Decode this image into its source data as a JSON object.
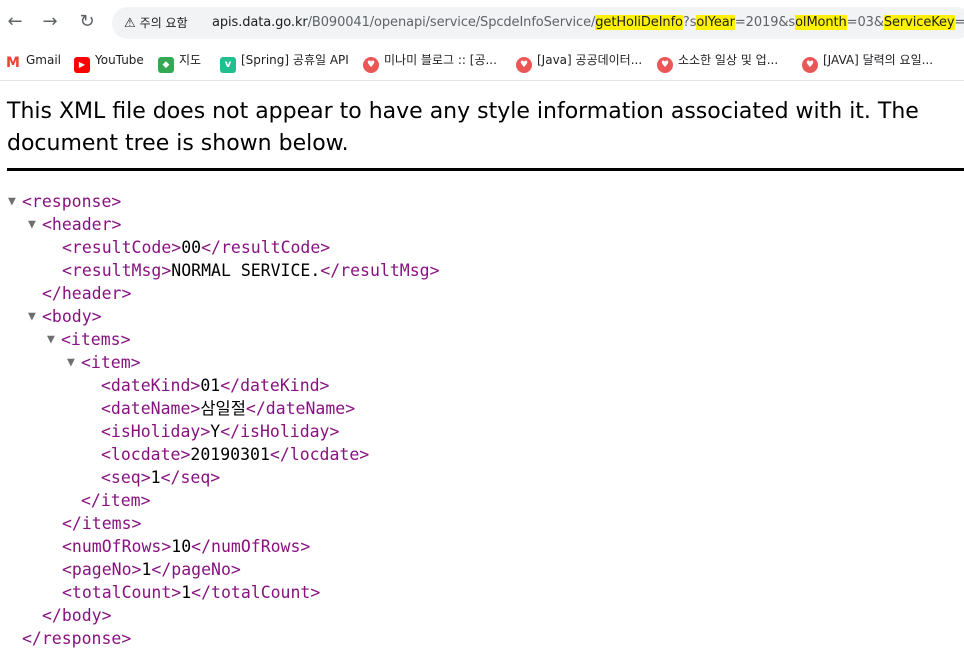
{
  "browser": {
    "back_icon": "←",
    "forward_icon": "→",
    "reload_icon": "↻",
    "security_chip": {
      "icon": "⚠",
      "label": "주의 요함"
    },
    "url": {
      "host": "apis.data.go.kr",
      "path": "/B090041/openapi/service/SpcdeInfoService/",
      "op": "getHoliDeInfo",
      "q1_pre": "?s",
      "q1_hl": "olYear",
      "q1_val": "=2019&s",
      "q2_hl": "olMonth",
      "q2_val": "=03&",
      "q3_hl": "ServiceKey",
      "q3_val": "=Ar"
    }
  },
  "bookmarks": [
    {
      "label": "Gmail",
      "icon": "M",
      "color": "#ea4335"
    },
    {
      "label": "YouTube",
      "icon": "▶",
      "color": "#ff0000"
    },
    {
      "label": "지도",
      "icon": "◆",
      "color": "#34a853"
    },
    {
      "label": "[Spring] 공휴일 API",
      "icon": "v",
      "color": "#1fbf8f"
    },
    {
      "label": "미나미 블로그 :: [공...",
      "icon": "♥",
      "color": "#eb5757"
    },
    {
      "label": "[Java] 공공데이터...",
      "icon": "♥",
      "color": "#eb5757"
    },
    {
      "label": "소소한 일상 및 업...",
      "icon": "♥",
      "color": "#eb5757"
    },
    {
      "label": "[JAVA] 달력의 요일...",
      "icon": "♥",
      "color": "#eb5757"
    }
  ],
  "notice": {
    "text": "This XML file does not appear to have any style information associated with it. The document tree is shown below."
  },
  "xml": {
    "toggle": "▼",
    "response_open": "<response>",
    "response_close": "</response>",
    "header_open": "<header>",
    "header_close": "</header>",
    "resultCode": {
      "open": "<resultCode>",
      "value": "00",
      "close": "</resultCode>"
    },
    "resultMsg": {
      "open": "<resultMsg>",
      "value": "NORMAL SERVICE.",
      "close": "</resultMsg>"
    },
    "body_open": "<body>",
    "body_close": "</body>",
    "items_open": "<items>",
    "items_close": "</items>",
    "item_open": "<item>",
    "item_close": "</item>",
    "dateKind": {
      "open": "<dateKind>",
      "value": "01",
      "close": "</dateKind>"
    },
    "dateName": {
      "open": "<dateName>",
      "value": "삼일절",
      "close": "</dateName>"
    },
    "isHoliday": {
      "open": "<isHoliday>",
      "value": "Y",
      "close": "</isHoliday>"
    },
    "locdate": {
      "open": "<locdate>",
      "value": "20190301",
      "close": "</locdate>"
    },
    "seq": {
      "open": "<seq>",
      "value": "1",
      "close": "</seq>"
    },
    "numOfRows": {
      "open": "<numOfRows>",
      "value": "10",
      "close": "</numOfRows>"
    },
    "pageNo": {
      "open": "<pageNo>",
      "value": "1",
      "close": "</pageNo>"
    },
    "totalCount": {
      "open": "<totalCount>",
      "value": "1",
      "close": "</totalCount>"
    }
  }
}
